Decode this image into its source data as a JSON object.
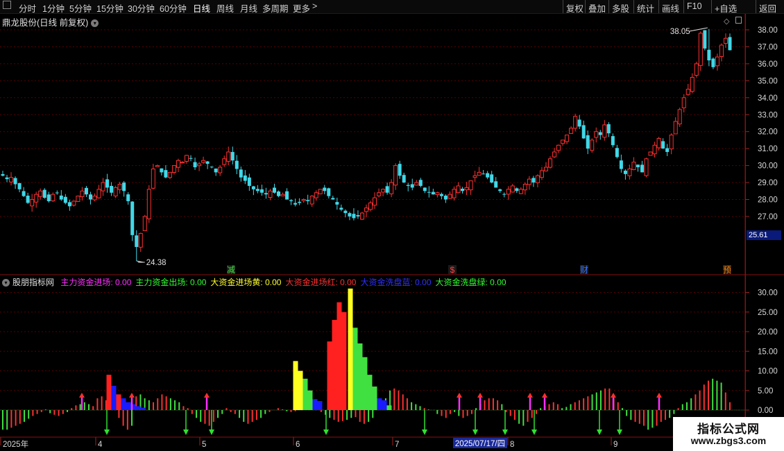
{
  "toolbar": {
    "periods": [
      "分时",
      "1分钟",
      "5分钟",
      "15分钟",
      "30分钟",
      "60分钟",
      "日线",
      "周线",
      "月线",
      "多周期",
      "更多"
    ],
    "active_period": "日线",
    "more_arrow": ">",
    "right_buttons": [
      "复权",
      "叠加",
      "多股",
      "统计",
      "画线",
      "F10",
      "+自选",
      "返回"
    ]
  },
  "price_panel": {
    "title": "鼎龙股份(日线 前复权)",
    "last_price": "25.61",
    "high_label": "38.05",
    "low_label": "24.38",
    "y_ticks": [
      "38.00",
      "37.00",
      "36.00",
      "35.00",
      "34.00",
      "33.00",
      "32.00",
      "31.00",
      "30.00",
      "29.00",
      "28.00",
      "27.00"
    ],
    "event_tags": [
      {
        "text": "减",
        "color": "#40e040"
      },
      {
        "text": "$",
        "color": "#ff4040"
      },
      {
        "text": "财",
        "color": "#3070ff"
      },
      {
        "text": "预",
        "color": "#ff8000"
      }
    ]
  },
  "indicator_panel": {
    "name": "股朋指标网",
    "items": [
      {
        "label": "主力资金进场: 0.00",
        "color": "#ff30ff"
      },
      {
        "label": "主力资金出场: 0.00",
        "color": "#30ff30"
      },
      {
        "label": "大资金进场黄: 0.00",
        "color": "#ffff30"
      },
      {
        "label": "大资金进场红: 0.00",
        "color": "#ff3030"
      },
      {
        "label": "大资金洗盘蓝: 0.00",
        "color": "#3030ff"
      },
      {
        "label": "大资金洗盘绿: 0.00",
        "color": "#30ff30"
      }
    ],
    "y_ticks": [
      "30.00",
      "25.00",
      "20.00",
      "15.00",
      "10.00",
      "5.00",
      "0.00"
    ]
  },
  "date_axis": {
    "labels": [
      "2025年",
      "4",
      "5",
      "6",
      "7",
      "8",
      "9"
    ],
    "cursor_date": "2025/07/17/四"
  },
  "watermark": {
    "line1": "指标公式网",
    "line2": "www.zbgs3.com"
  },
  "icons": [
    "chevron-down-icon",
    "diamond-icon",
    "scroll-box-icon",
    "arrow-up-icon",
    "arrow-down-icon"
  ],
  "chart_data": {
    "type": "candlestick",
    "title": "鼎龙股份(日线 前复权)",
    "price_range": [
      24.0,
      38.6
    ],
    "high": 38.05,
    "low": 24.38,
    "last": 25.61,
    "closes": [
      29.4,
      29.2,
      29.3,
      28.9,
      28.6,
      28.2,
      27.8,
      28.0,
      28.3,
      28.5,
      28.1,
      27.9,
      28.3,
      28.4,
      28.0,
      27.8,
      27.6,
      27.9,
      28.2,
      28.5,
      28.3,
      28.0,
      28.2,
      28.6,
      29.0,
      28.7,
      28.4,
      28.7,
      28.9,
      28.5,
      27.9,
      25.9,
      25.2,
      26.0,
      27.0,
      28.6,
      29.8,
      30.0,
      29.6,
      29.3,
      29.6,
      30.0,
      30.3,
      30.2,
      30.6,
      30.4,
      29.9,
      30.1,
      30.3,
      30.1,
      29.9,
      29.6,
      29.9,
      30.4,
      30.8,
      30.3,
      29.8,
      29.3,
      29.1,
      28.8,
      28.6,
      28.5,
      28.4,
      28.3,
      28.5,
      28.4,
      28.2,
      28.3,
      28.0,
      27.9,
      27.7,
      27.8,
      28.0,
      27.9,
      28.2,
      28.4,
      28.6,
      28.5,
      28.2,
      28.0,
      27.7,
      27.4,
      27.2,
      27.0,
      26.9,
      27.0,
      27.2,
      27.5,
      27.8,
      28.1,
      28.4,
      28.6,
      28.4,
      29.0,
      30.0,
      29.4,
      29.0,
      28.8,
      28.7,
      29.0,
      28.8,
      28.5,
      28.4,
      28.3,
      28.4,
      28.2,
      28.0,
      28.3,
      28.6,
      28.8,
      28.5,
      28.7,
      29.1,
      29.4,
      29.6,
      29.5,
      29.3,
      29.0,
      28.7,
      28.5,
      28.3,
      28.6,
      28.8,
      28.5,
      28.6,
      28.9,
      29.2,
      29.0,
      29.4,
      29.7,
      29.9,
      30.4,
      30.8,
      31.2,
      31.5,
      31.8,
      32.2,
      32.9,
      32.3,
      31.6,
      31.0,
      31.5,
      32.0,
      31.8,
      32.4,
      31.9,
      31.2,
      30.5,
      29.8,
      29.5,
      29.8,
      30.2,
      29.9,
      29.6,
      30.4,
      30.8,
      31.2,
      31.6,
      31.0,
      30.8,
      31.8,
      32.6,
      33.3,
      34.0,
      34.5,
      35.2,
      36.0,
      37.8,
      36.9,
      36.2,
      35.8,
      36.4,
      37.1,
      37.5,
      36.8
    ]
  }
}
